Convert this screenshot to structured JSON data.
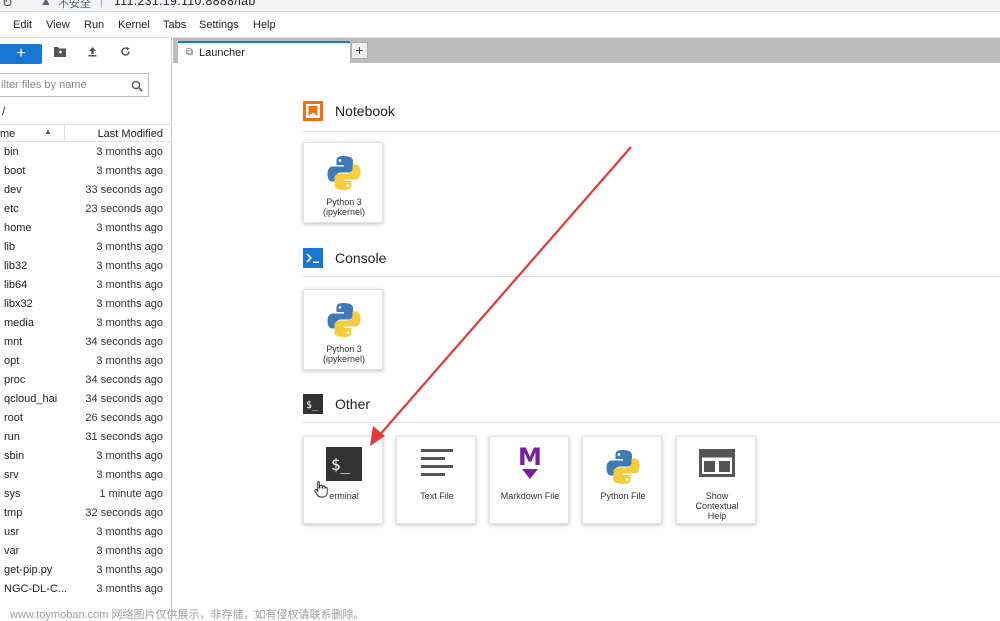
{
  "browser": {
    "security_label": "不安全",
    "url": "111.231.19.110:8888/lab"
  },
  "menu": [
    "Edit",
    "View",
    "Run",
    "Kernel",
    "Tabs",
    "Settings",
    "Help"
  ],
  "sidebar": {
    "new_label": "+",
    "filter_placeholder": "ilter files by name",
    "breadcrumb": "/",
    "col_name": "me",
    "col_modified": "Last Modified",
    "files": [
      {
        "name": "bin",
        "modified": "3 months ago"
      },
      {
        "name": "boot",
        "modified": "3 months ago"
      },
      {
        "name": "dev",
        "modified": "33 seconds ago"
      },
      {
        "name": "etc",
        "modified": "23 seconds ago"
      },
      {
        "name": "home",
        "modified": "3 months ago"
      },
      {
        "name": "lib",
        "modified": "3 months ago"
      },
      {
        "name": "lib32",
        "modified": "3 months ago"
      },
      {
        "name": "lib64",
        "modified": "3 months ago"
      },
      {
        "name": "libx32",
        "modified": "3 months ago"
      },
      {
        "name": "media",
        "modified": "3 months ago"
      },
      {
        "name": "mnt",
        "modified": "34 seconds ago"
      },
      {
        "name": "opt",
        "modified": "3 months ago"
      },
      {
        "name": "proc",
        "modified": "34 seconds ago"
      },
      {
        "name": "qcloud_hai",
        "modified": "34 seconds ago"
      },
      {
        "name": "root",
        "modified": "26 seconds ago"
      },
      {
        "name": "run",
        "modified": "31 seconds ago"
      },
      {
        "name": "sbin",
        "modified": "3 months ago"
      },
      {
        "name": "srv",
        "modified": "3 months ago"
      },
      {
        "name": "sys",
        "modified": "1 minute ago"
      },
      {
        "name": "tmp",
        "modified": "32 seconds ago"
      },
      {
        "name": "usr",
        "modified": "3 months ago"
      },
      {
        "name": "var",
        "modified": "3 months ago"
      },
      {
        "name": "get-pip.py",
        "modified": "3 months ago"
      },
      {
        "name": "NGC-DL-C...",
        "modified": "3 months ago"
      }
    ]
  },
  "tabs": {
    "launcher_label": "Launcher",
    "add_label": "+"
  },
  "launcher": {
    "notebook": {
      "title": "Notebook",
      "card_label": "Python 3 (ipykernel)"
    },
    "console": {
      "title": "Console",
      "card_label": "Python 3 (ipykernel)"
    },
    "other": {
      "title": "Other",
      "cards": {
        "terminal": "erminal",
        "text_file": "Text File",
        "markdown_file": "Markdown File",
        "python_file": "Python File",
        "contextual_help": "Show Contextual Help"
      }
    }
  },
  "colors": {
    "accent": "#1976d2",
    "notebook_icon": "#e8711a",
    "markdown_icon": "#7b1fa2",
    "arrow": "#e53935"
  },
  "watermark": "www.toymoban.com 网络图片仅供展示，非存储，如有侵权请联系删除。"
}
